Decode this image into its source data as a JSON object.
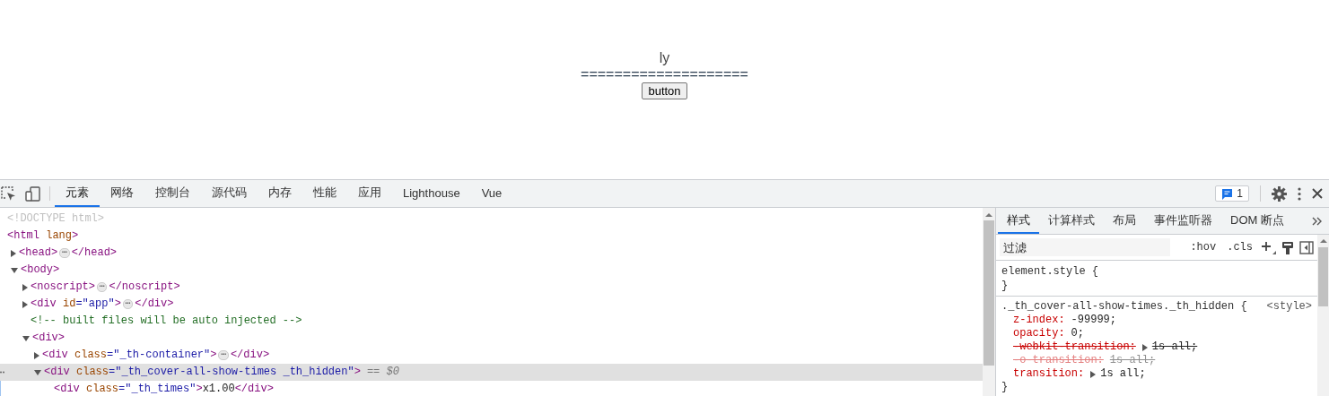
{
  "page": {
    "title": "ly",
    "rule": "====================",
    "button": "button"
  },
  "devtools": {
    "toolbar": {
      "tabs": [
        {
          "label": "元素",
          "selected": true
        },
        {
          "label": "网络",
          "selected": false
        },
        {
          "label": "控制台",
          "selected": false
        },
        {
          "label": "源代码",
          "selected": false
        },
        {
          "label": "内存",
          "selected": false
        },
        {
          "label": "性能",
          "selected": false
        },
        {
          "label": "应用",
          "selected": false
        },
        {
          "label": "Lighthouse",
          "selected": false
        },
        {
          "label": "Vue",
          "selected": false
        }
      ],
      "issues_count": "1"
    },
    "elements": {
      "nodes": [
        {
          "segments": [
            {
              "kind": "doctype",
              "text": "<!DOCTYPE html>"
            }
          ]
        },
        {
          "segments": [
            {
              "kind": "tag",
              "text": "<html"
            },
            {
              "kind": "attr",
              "text": " lang"
            },
            {
              "kind": "tag",
              "text": ">"
            }
          ],
          "children": [
            {
              "expanded": false,
              "segments": [
                {
                  "kind": "tag",
                  "text": "<head>"
                },
                {
                  "kind": "ellipsis",
                  "text": "⋯"
                },
                {
                  "kind": "tag",
                  "text": "</head>"
                }
              ]
            },
            {
              "expanded": true,
              "segments": [
                {
                  "kind": "tag",
                  "text": "<body>"
                }
              ],
              "children": [
                {
                  "expanded": false,
                  "segments": [
                    {
                      "kind": "tag",
                      "text": "<noscript>"
                    },
                    {
                      "kind": "ellipsis",
                      "text": "⋯"
                    },
                    {
                      "kind": "tag",
                      "text": "</noscript>"
                    }
                  ]
                },
                {
                  "expanded": false,
                  "segments": [
                    {
                      "kind": "tag",
                      "text": "<div"
                    },
                    {
                      "kind": "attr",
                      "text": " id"
                    },
                    {
                      "kind": "value",
                      "text": "=\"app\""
                    },
                    {
                      "kind": "tag",
                      "text": ">"
                    },
                    {
                      "kind": "ellipsis",
                      "text": "⋯"
                    },
                    {
                      "kind": "tag",
                      "text": "</div>"
                    }
                  ]
                },
                {
                  "segments": [
                    {
                      "kind": "comment",
                      "text": "<!-- built files will be auto injected -->"
                    }
                  ]
                },
                {
                  "expanded": true,
                  "segments": [
                    {
                      "kind": "tag",
                      "text": "<div>"
                    }
                  ],
                  "children": [
                    {
                      "expanded": false,
                      "segments": [
                        {
                          "kind": "tag",
                          "text": "<div"
                        },
                        {
                          "kind": "attr",
                          "text": " class"
                        },
                        {
                          "kind": "value",
                          "text": "=\"_th-container\""
                        },
                        {
                          "kind": "tag",
                          "text": ">"
                        },
                        {
                          "kind": "ellipsis",
                          "text": "⋯"
                        },
                        {
                          "kind": "tag",
                          "text": "</div>"
                        }
                      ]
                    },
                    {
                      "expanded": true,
                      "selected": true,
                      "segments": [
                        {
                          "kind": "tag",
                          "text": "<div"
                        },
                        {
                          "kind": "attr",
                          "text": " class"
                        },
                        {
                          "kind": "value",
                          "text": "=\"_th_cover-all-show-times _th_hidden\""
                        },
                        {
                          "kind": "tag",
                          "text": ">"
                        },
                        {
                          "kind": "marker",
                          "text": "== $0"
                        }
                      ],
                      "children": [
                        {
                          "segments": [
                            {
                              "kind": "tag",
                              "text": "<div"
                            },
                            {
                              "kind": "attr",
                              "text": " class"
                            },
                            {
                              "kind": "value",
                              "text": "=\"_th_times\""
                            },
                            {
                              "kind": "tag",
                              "text": ">"
                            },
                            {
                              "kind": "text",
                              "text": "x1.00"
                            },
                            {
                              "kind": "tag",
                              "text": "</div>"
                            }
                          ]
                        }
                      ]
                    }
                  ]
                }
              ]
            }
          ]
        }
      ]
    },
    "styles": {
      "tabs": [
        {
          "label": "样式",
          "selected": true
        },
        {
          "label": "计算样式",
          "selected": false
        },
        {
          "label": "布局",
          "selected": false
        },
        {
          "label": "事件监听器",
          "selected": false
        },
        {
          "label": "DOM 断点",
          "selected": false
        }
      ],
      "filter": {
        "placeholder": "过滤"
      },
      "toggles": [
        ":hov",
        ".cls"
      ],
      "rules": [
        {
          "selector": "element.style {",
          "close": "}"
        },
        {
          "selector": "._th_cover-all-show-times._th_hidden {",
          "source": "<style>",
          "close": "}",
          "declarations": [
            {
              "property": "z-index:",
              "value": "-99999;",
              "overridden": false,
              "inactive": false,
              "expandable": false
            },
            {
              "property": "opacity:",
              "value": "0;",
              "overridden": false,
              "inactive": false,
              "expandable": false
            },
            {
              "property": "-webkit-transition:",
              "value": "1s all;",
              "overridden": true,
              "inactive": false,
              "expandable": true
            },
            {
              "property": "-o-transition:",
              "value": "1s all;",
              "overridden": true,
              "inactive": true,
              "expandable": false
            },
            {
              "property": "transition:",
              "value": "1s all;",
              "overridden": false,
              "inactive": false,
              "expandable": true
            }
          ]
        }
      ]
    }
  }
}
